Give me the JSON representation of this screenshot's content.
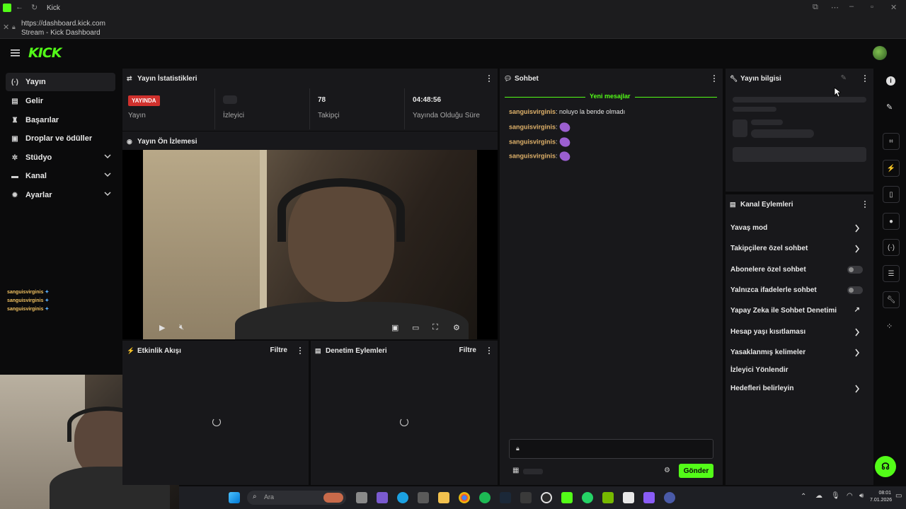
{
  "browser": {
    "tab_title": "Kick",
    "url": "https://dashboard.kick.com",
    "page_title": "Stream - Kick Dashboard"
  },
  "header": {
    "logo": "KICK"
  },
  "sidebar": {
    "items": [
      {
        "label": "Yayın",
        "icon": "broadcast-icon"
      },
      {
        "label": "Gelir",
        "icon": "money-icon"
      },
      {
        "label": "Başarılar",
        "icon": "trophy-icon"
      },
      {
        "label": "Droplar ve ödüller",
        "icon": "gift-icon"
      },
      {
        "label": "Stüdyo",
        "icon": "gear-icon"
      },
      {
        "label": "Kanal",
        "icon": "channel-icon"
      },
      {
        "label": "Ayarlar",
        "icon": "settings-icon"
      }
    ]
  },
  "overlay_chat": {
    "lines": [
      "sanguisvirginis",
      "sanguisvirginis",
      "sanguisvirginis"
    ]
  },
  "stats_panel": {
    "title": "Yayın İstatistikleri",
    "live_badge": "YAYINDA",
    "live_label": "Yayın",
    "viewers_label": "İzleyici",
    "followers_value": "78",
    "followers_label": "Takipçi",
    "uptime_value": "04:48:56",
    "uptime_label": "Yayında Olduğu Süre"
  },
  "preview_panel": {
    "title": "Yayın Ön İzlemesi"
  },
  "activity_panel": {
    "title": "Etkinlik Akışı",
    "filter": "Filtre"
  },
  "mod_panel": {
    "title": "Denetim Eylemleri",
    "filter": "Filtre"
  },
  "chat_panel": {
    "title": "Sohbet",
    "new_messages": "Yeni mesajlar",
    "messages": [
      {
        "user": "sanguisvirginis",
        "text": ": noluyo la bende olmadı"
      },
      {
        "user": "sanguisvirginis",
        "text": ":"
      },
      {
        "user": "sanguisvirginis",
        "text": ":"
      },
      {
        "user": "sanguisvirginis",
        "text": ":"
      }
    ],
    "send_label": "Gönder"
  },
  "info_panel": {
    "title": "Yayın bilgisi"
  },
  "actions_panel": {
    "title": "Kanal Eylemleri",
    "items": [
      {
        "label": "Yavaş mod",
        "control": "chevron"
      },
      {
        "label": "Takipçilere özel sohbet",
        "control": "chevron"
      },
      {
        "label": "Abonelere özel sohbet",
        "control": "toggle"
      },
      {
        "label": "Yalnızca ifadelerle sohbet",
        "control": "toggle"
      },
      {
        "label": "Yapay Zeka ile Sohbet Denetimi",
        "control": "external"
      },
      {
        "label": "Hesap yaşı kısıtlaması",
        "control": "chevron"
      },
      {
        "label": "Yasaklanmış kelimeler",
        "control": "chevron"
      },
      {
        "label": "İzleyici Yönlendir",
        "control": "none"
      },
      {
        "label": "Hedefleri belirleyin",
        "control": "chevron"
      }
    ]
  },
  "taskbar": {
    "search_placeholder": "Ara",
    "time": "08:01",
    "date": "7.01.2026"
  },
  "colors": {
    "accent": "#53fc18",
    "live": "#d0312d",
    "panel": "#18181b"
  }
}
